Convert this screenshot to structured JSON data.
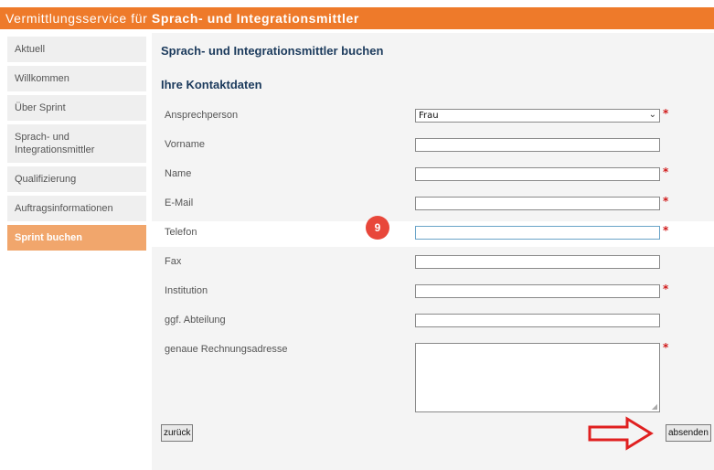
{
  "header": {
    "title_prefix": "Vermittlungsservice für ",
    "title_strong": "Sprach- und Integrationsmittler"
  },
  "sidebar": {
    "items": [
      {
        "label": "Aktuell"
      },
      {
        "label": "Willkommen"
      },
      {
        "label": "Über Sprint"
      },
      {
        "label_line1": "Sprach- und",
        "label_line2": "Integrationsmittler"
      },
      {
        "label": "Qualifizierung"
      },
      {
        "label": "Auftragsinformationen"
      },
      {
        "label": "Sprint buchen"
      }
    ]
  },
  "main": {
    "heading": "Sprach- und Integrationsmittler buchen",
    "subheading": "Ihre Kontaktdaten",
    "fields": {
      "ansprechperson": {
        "label": "Ansprechperson",
        "value": "Frau"
      },
      "vorname": {
        "label": "Vorname",
        "value": ""
      },
      "name": {
        "label": "Name",
        "value": ""
      },
      "email": {
        "label": "E-Mail",
        "value": ""
      },
      "telefon": {
        "label": "Telefon",
        "value": ""
      },
      "fax": {
        "label": "Fax",
        "value": ""
      },
      "institution": {
        "label": "Institution",
        "value": ""
      },
      "abteilung": {
        "label": "ggf. Abteilung",
        "value": ""
      },
      "rechnungsadresse": {
        "label": "genaue Rechnungsadresse",
        "value": ""
      }
    },
    "required_marker": "*",
    "step_badge": "9",
    "buttons": {
      "back": "zurück",
      "submit": "absenden"
    }
  },
  "colors": {
    "header_orange": "#ee7a2a",
    "active_nav": "#f1a66c",
    "heading_blue": "#1b3a5c",
    "required_red": "#d01818",
    "badge_red": "#e8473a",
    "arrow_red": "#e02020"
  }
}
